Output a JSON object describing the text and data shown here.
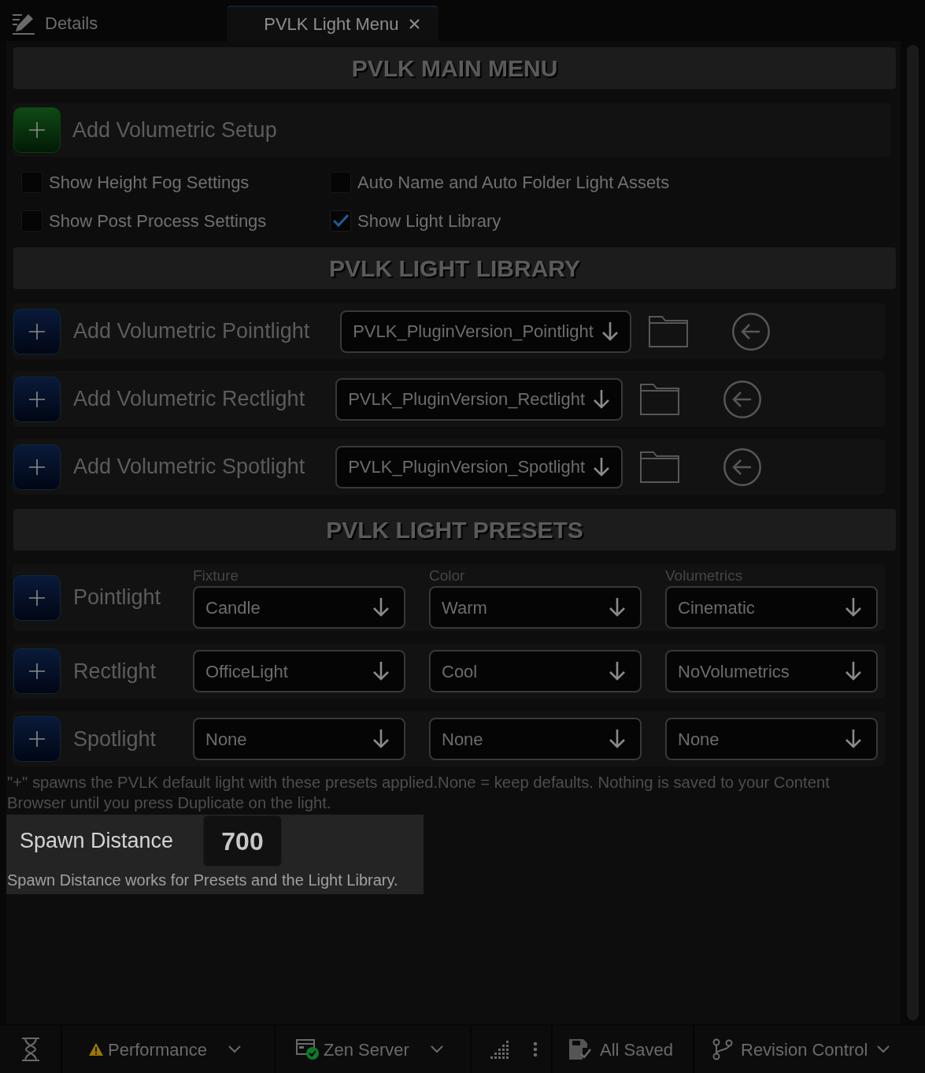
{
  "tabs": [
    {
      "label": "Details",
      "selected": false,
      "closable": false
    },
    {
      "label": "PVLK Light Menu",
      "selected": true,
      "closable": true
    }
  ],
  "main_menu": {
    "title": "PVLK MAIN MENU",
    "setup_button": {
      "label": "Add Volumetric Setup"
    },
    "options": [
      {
        "label": "Show Height Fog Settings",
        "checked": false
      },
      {
        "label": "Auto Name and Auto Folder Light Assets",
        "checked": false
      },
      {
        "label": "Show Post Process Settings",
        "checked": false
      },
      {
        "label": "Show Light Library",
        "checked": true
      }
    ]
  },
  "light_library": {
    "title": "PVLK LIGHT LIBRARY",
    "rows": [
      {
        "label": "Add Volumetric Pointlight",
        "asset": "PVLK_PluginVersion_Pointlight"
      },
      {
        "label": "Add Volumetric Rectlight",
        "asset": "PVLK_PluginVersion_Rectlight"
      },
      {
        "label": "Add Volumetric Spotlight",
        "asset": "PVLK_PluginVersion_Spotlight"
      }
    ]
  },
  "light_presets": {
    "title": "PVLK LIGHT PRESETS",
    "columns": [
      "Fixture",
      "Color",
      "Volumetrics"
    ],
    "rows": [
      {
        "label": "Pointlight",
        "values": [
          "Candle",
          "Warm",
          "Cinematic"
        ]
      },
      {
        "label": "Rectlight",
        "values": [
          "OfficeLight",
          "Cool",
          "NoVolumetrics"
        ]
      },
      {
        "label": "Spotlight",
        "values": [
          "None",
          "None",
          "None"
        ]
      }
    ],
    "note": "\"+\" spawns the PVLK default light with these presets applied.None = keep defaults. Nothing is saved to your Content Browser until you press Duplicate on the light."
  },
  "spawn_distance": {
    "label": "Spawn Distance",
    "value": "700",
    "note": "Spawn Distance works for Presets and the Light Library."
  },
  "status_bar": {
    "items": [
      {
        "kind": "trace"
      },
      {
        "kind": "performance",
        "label": "Performance",
        "dropdown": true
      },
      {
        "kind": "zen",
        "label": "Zen Server",
        "dropdown": true
      },
      {
        "kind": "derived_data"
      },
      {
        "kind": "save",
        "label": "All Saved",
        "dropdown": false
      },
      {
        "kind": "revision",
        "label": "Revision Control",
        "dropdown": true
      }
    ]
  }
}
